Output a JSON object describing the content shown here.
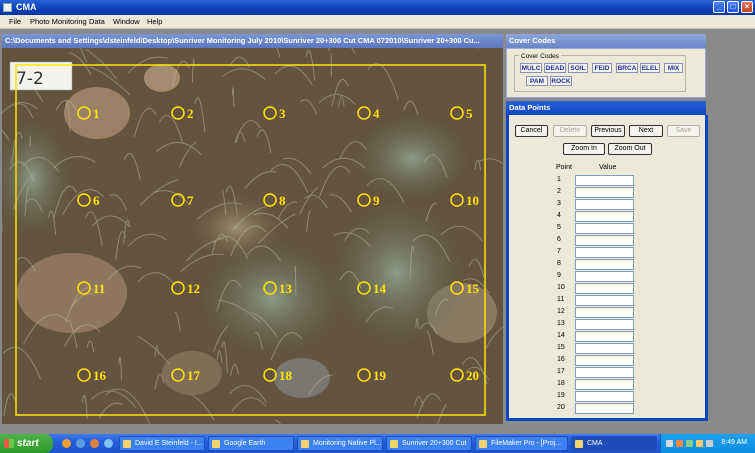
{
  "window": {
    "title": "CMA"
  },
  "menu": [
    "File",
    "Photo Monitoring",
    "Data",
    "Window",
    "Help"
  ],
  "photo": {
    "path": "C:\\Documents and Settings\\dsteinfeld\\Desktop\\Sunriver Monitoring July 2010\\Sunriver 20+300 Cut CMA 072010\\Sunriver 20+300 Cu...",
    "sign_text": "7-2",
    "points": [
      "1",
      "2",
      "3",
      "4",
      "5",
      "6",
      "7",
      "8",
      "9",
      "10",
      "11",
      "12",
      "13",
      "14",
      "15",
      "16",
      "17",
      "18",
      "19",
      "20"
    ]
  },
  "cover_codes": {
    "title": "Cover Codes",
    "group_label": "Cover Codes",
    "codes": [
      "MULC",
      "DEAD",
      "SOIL",
      "FEID",
      "BRCA",
      "ELEL",
      "MIX",
      "PAM",
      "ROCK"
    ]
  },
  "data_points": {
    "title": "Data Points",
    "buttons": {
      "cancel": "Cancel",
      "delete": "Delete",
      "previous": "Previous",
      "next": "Next",
      "save": "Save",
      "zoom_in": "Zoom In",
      "zoom_out": "Zoom Out"
    },
    "col_point": "Point",
    "col_value": "Value",
    "rows": [
      "1",
      "2",
      "3",
      "4",
      "5",
      "6",
      "7",
      "8",
      "9",
      "10",
      "11",
      "12",
      "13",
      "14",
      "15",
      "16",
      "17",
      "18",
      "19",
      "20"
    ],
    "values": [
      "",
      "",
      "",
      "",
      "",
      "",
      "",
      "",
      "",
      "",
      "",
      "",
      "",
      "",
      "",
      "",
      "",
      "",
      "",
      ""
    ]
  },
  "taskbar": {
    "start": "start",
    "tasks": [
      "David E Steinfeld - I...",
      "Google Earth",
      "Monitoring Native Pl...",
      "Sunriver 20+300 Cut",
      "FileMaker Pro - [Proj...",
      "CMA"
    ],
    "clock": "8:49 AM"
  },
  "colors": {
    "title_blue": "#0a3fb6",
    "grid_yellow": "#ffe600",
    "panel_bg": "#ece9d8",
    "code_text": "#20309a"
  }
}
